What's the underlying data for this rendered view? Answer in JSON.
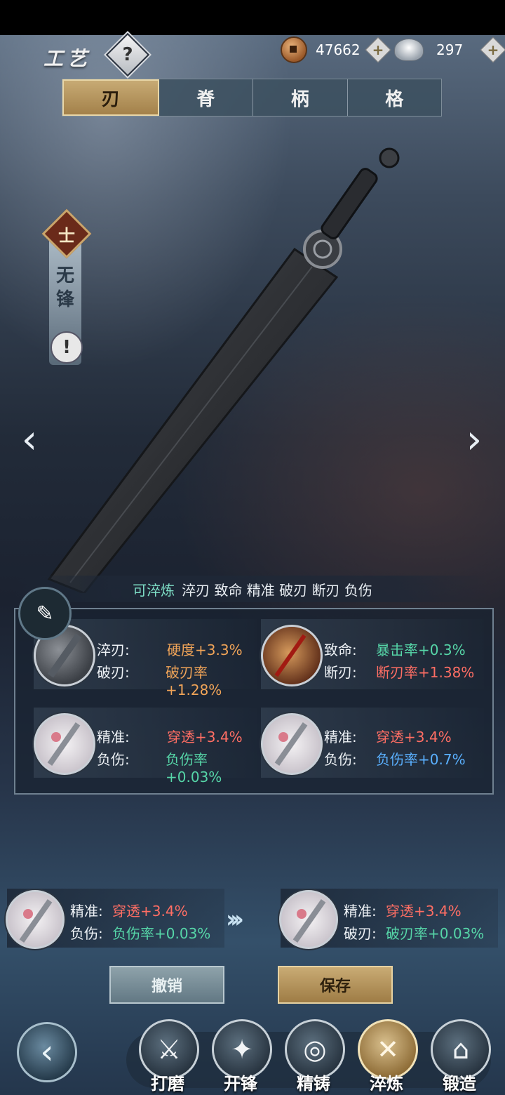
{
  "header": {
    "title": "工艺",
    "help_icon": "?",
    "copper": "47662",
    "silver": "297",
    "plus_icon": "+"
  },
  "tabs": [
    {
      "label": "刃",
      "active": true
    },
    {
      "label": "脊",
      "active": false
    },
    {
      "label": "柄",
      "active": false
    },
    {
      "label": "格",
      "active": false
    }
  ],
  "weapon": {
    "rank_icon": "士",
    "name": "无锋",
    "info_icon": "!"
  },
  "nav_arrows": {
    "prev": "‹",
    "next": "›"
  },
  "refine_summary": {
    "label": "可淬炼",
    "traits": "淬刃 致命 精准 破刃 断刃 负伤"
  },
  "slots": [
    {
      "icon": "steel",
      "r1_name": "淬刃:",
      "r1_val": "硬度+3.3%",
      "r1_color": "#f0a458",
      "r2_name": "破刃:",
      "r2_val": "破刃率+1.28%",
      "r2_color": "#f0a458"
    },
    {
      "icon": "flame",
      "r1_name": "致命:",
      "r1_val": "暴击率+0.3%",
      "r1_color": "#56d6a8",
      "r2_name": "断刃:",
      "r2_val": "断刃率+1.38%",
      "r2_color": "#ff6e64"
    },
    {
      "icon": "blossom",
      "r1_name": "精准:",
      "r1_val": "穿透+3.4%",
      "r1_color": "#ff6e64",
      "r2_name": "负伤:",
      "r2_val": "负伤率+0.03%",
      "r2_color": "#56d6a8"
    },
    {
      "icon": "blossom",
      "r1_name": "精准:",
      "r1_val": "穿透+3.4%",
      "r1_color": "#ff6e64",
      "r2_name": "负伤:",
      "r2_val": "负伤率+0.7%",
      "r2_color": "#5ab0ff"
    }
  ],
  "compare": {
    "before": {
      "r1_name": "精准:",
      "r1_val": "穿透+3.4%",
      "r2_name": "负伤:",
      "r2_val": "负伤率+0.03%"
    },
    "after": {
      "r1_name": "精准:",
      "r1_val": "穿透+3.4%",
      "r2_name": "破刃:",
      "r2_val": "破刃率+0.03%"
    },
    "arrow": "›››"
  },
  "actions": {
    "cancel": "撤销",
    "save": "保存"
  },
  "bottom_nav": {
    "back_icon": "‹",
    "items": [
      {
        "label": "打磨",
        "icon": "⚔",
        "active": false
      },
      {
        "label": "开锋",
        "icon": "✦",
        "active": false
      },
      {
        "label": "精铸",
        "icon": "◎",
        "active": false
      },
      {
        "label": "淬炼",
        "icon": "✕",
        "active": true
      },
      {
        "label": "锻造",
        "icon": "⌂",
        "active": false
      }
    ]
  }
}
